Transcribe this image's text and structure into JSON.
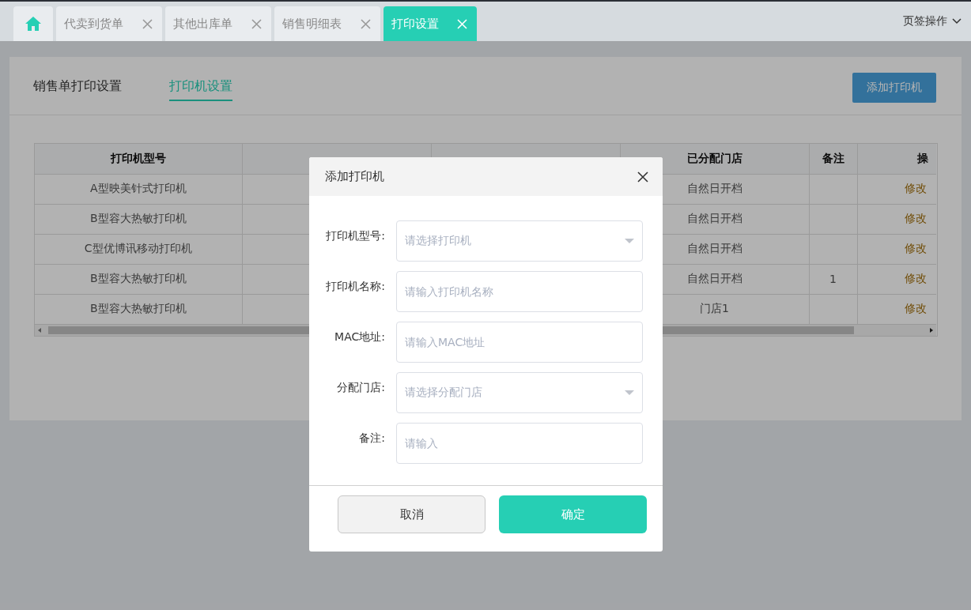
{
  "tabs": [
    {
      "kind": "home",
      "selected": false
    },
    {
      "kind": "page",
      "label": "代卖到货单",
      "selected": false
    },
    {
      "kind": "page",
      "label": "其他出库单",
      "selected": false
    },
    {
      "kind": "page",
      "label": "销售明细表",
      "selected": false
    },
    {
      "kind": "page",
      "label": "打印设置",
      "selected": true
    }
  ],
  "tab_actions": {
    "label": "页签操作"
  },
  "subtabs": [
    {
      "label": "销售单打印设置",
      "selected": false
    },
    {
      "label": "打印机设置",
      "selected": true
    }
  ],
  "add_button": {
    "label": "添加打印机"
  },
  "table": {
    "columns": [
      {
        "label": "打印机型号"
      },
      {},
      {},
      {
        "label": "已分配门店"
      },
      {
        "label": "备注"
      },
      {
        "label": "操"
      }
    ],
    "rows": [
      {
        "model": "A型映美针式打印机",
        "store": "自然日开档",
        "action": "修改"
      },
      {
        "model": "B型容大热敏打印机",
        "store": "自然日开档",
        "action": "修改"
      },
      {
        "model": "C型优博讯移动打印机",
        "store": "自然日开档",
        "action": "修改"
      },
      {
        "model": "B型容大热敏打印机",
        "store": "自然日开档",
        "note": "1",
        "action": "修改"
      },
      {
        "model": "B型容大热敏打印机",
        "store": "门店1",
        "action": "修改"
      }
    ]
  },
  "dialog": {
    "title": "添加打印机",
    "fields": [
      {
        "kind": "select",
        "label": "打印机型号:",
        "placeholder": "请选择打印机"
      },
      {
        "kind": "input",
        "label": "打印机名称:",
        "placeholder": "请输入打印机名称"
      },
      {
        "kind": "input",
        "label": "MAC地址:",
        "placeholder": "请输入MAC地址"
      },
      {
        "kind": "select",
        "label": "分配门店:",
        "placeholder": "请选择分配门店"
      },
      {
        "kind": "input",
        "label": "备注:",
        "placeholder": "请输入"
      }
    ],
    "cancel": "取消",
    "confirm": "确定"
  }
}
